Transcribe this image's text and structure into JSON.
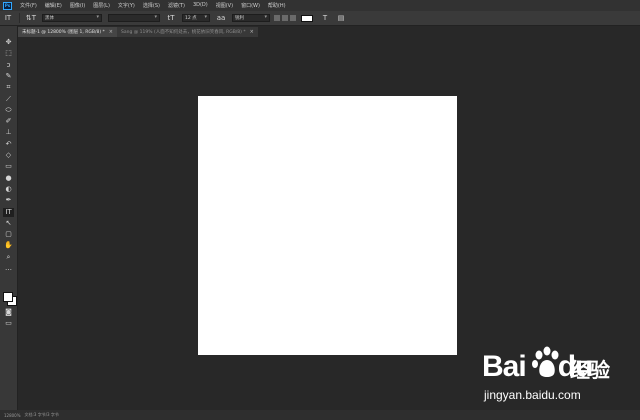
{
  "app": {
    "logo_text": "Ps"
  },
  "menu": [
    "文件(F)",
    "编辑(E)",
    "图像(I)",
    "图层(L)",
    "文字(Y)",
    "选择(S)",
    "滤镜(T)",
    "3D(D)",
    "视图(V)",
    "窗口(W)",
    "帮助(H)"
  ],
  "options": {
    "tool_icon": "IT",
    "orient_icon": "⇅T",
    "font_family": "黑体",
    "font_style": "",
    "size_icon": "tT",
    "font_size": "12 点",
    "aa_icon": "aa",
    "anti_alias": "锐利",
    "warp_icon": "T",
    "panel_icon": "▤",
    "text_color": "#ffffff"
  },
  "tabs": [
    {
      "label": "未标题-1 @ 12800% (图层 1, RGB/8) *",
      "active": true,
      "close": "×"
    },
    {
      "label": "Sang @ 119% (人面不知何处去，桃花依旧笑春风, RGB/8) *",
      "active": false,
      "close": "×"
    }
  ],
  "toolbar": {
    "tools": [
      {
        "name": "move",
        "glyph": "✥"
      },
      {
        "name": "marquee",
        "glyph": "⬚"
      },
      {
        "name": "lasso",
        "glyph": "ↄ"
      },
      {
        "name": "quick-select",
        "glyph": "✎"
      },
      {
        "name": "crop",
        "glyph": "⌗"
      },
      {
        "name": "eyedropper",
        "glyph": "⟋"
      },
      {
        "name": "spot-heal",
        "glyph": "⬭"
      },
      {
        "name": "brush",
        "glyph": "✐"
      },
      {
        "name": "stamp",
        "glyph": "⊥"
      },
      {
        "name": "history-brush",
        "glyph": "↶"
      },
      {
        "name": "eraser",
        "glyph": "◇"
      },
      {
        "name": "gradient",
        "glyph": "▭"
      },
      {
        "name": "blur",
        "glyph": "●"
      },
      {
        "name": "dodge",
        "glyph": "◐"
      },
      {
        "name": "pen",
        "glyph": "✒"
      },
      {
        "name": "type",
        "glyph": "IT",
        "selected": true
      },
      {
        "name": "path-select",
        "glyph": "↖"
      },
      {
        "name": "shape",
        "glyph": "▢"
      },
      {
        "name": "hand",
        "glyph": "✋"
      },
      {
        "name": "zoom",
        "glyph": "⌕"
      },
      {
        "name": "more",
        "glyph": "…"
      }
    ],
    "foreground": "#ffffff",
    "background": "#ffffff",
    "quickmask_glyph": "◙",
    "screenmode_glyph": "▭"
  },
  "status": {
    "zoom": "12800%",
    "doc": "文档:3 字节/3 字节"
  },
  "watermark": {
    "brand": "Bai",
    "brand_tail": "du",
    "cn": "经验",
    "url": "jingyan.baidu.com"
  }
}
